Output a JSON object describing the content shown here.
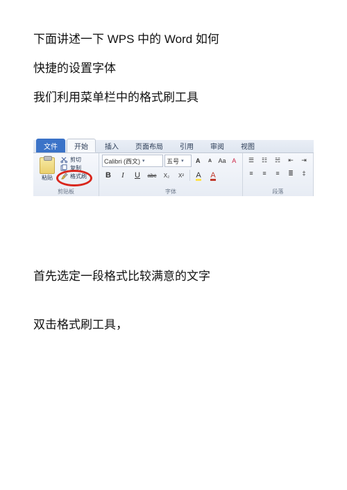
{
  "paragraphs": {
    "p1a": "下面讲述一下 WPS 中的 Word 如何",
    "p1b": "快捷的设置字体",
    "p2": "我们利用菜单栏中的格式刷工具",
    "p3": "首先选定一段格式比较满意的文字",
    "p4": "双击格式刷工具，"
  },
  "ribbon": {
    "tabs": {
      "file": "文件",
      "start": "开始",
      "insert": "插入",
      "layout": "页面布局",
      "ref": "引用",
      "review": "审阅",
      "view": "视图"
    },
    "clipboard": {
      "paste": "粘贴",
      "cut": "剪切",
      "copy": "复制",
      "brush": "格式刷",
      "group_label": "剪贴板"
    },
    "font": {
      "name": "Calibri (西文)",
      "size": "五号",
      "group_label": "字体",
      "bold": "B",
      "italic": "I",
      "underline": "U",
      "strike": "abc",
      "sub": "X₂",
      "sup": "X²",
      "grow": "A",
      "shrink": "A",
      "case": "Aa",
      "clear": "A",
      "highlight": "A",
      "color": "A"
    },
    "paragraph": {
      "group_label": "段落"
    }
  }
}
